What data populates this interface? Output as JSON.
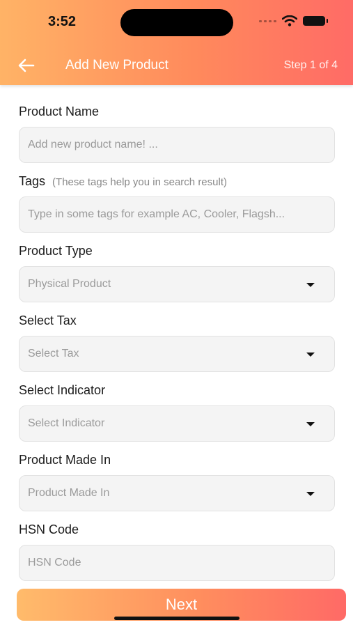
{
  "status_bar": {
    "time": "3:52"
  },
  "header": {
    "title": "Add New Product",
    "step": "Step 1 of 4"
  },
  "form": {
    "product_name": {
      "label": "Product Name",
      "placeholder": "Add new product name! ..."
    },
    "tags": {
      "label": "Tags",
      "hint": "(These tags help you in search result)",
      "placeholder": "Type in some tags for example AC, Cooler, Flagsh..."
    },
    "product_type": {
      "label": "Product Type",
      "value": "Physical Product"
    },
    "tax": {
      "label": "Select Tax",
      "value": "Select Tax"
    },
    "indicator": {
      "label": "Select Indicator",
      "value": "Select Indicator"
    },
    "made_in": {
      "label": "Product Made In",
      "value": "Product Made In"
    },
    "hsn": {
      "label": "HSN Code",
      "placeholder": "HSN Code"
    }
  },
  "footer": {
    "next_label": "Next"
  },
  "colors": {
    "gradient_start": "#ffb366",
    "gradient_end": "#ff6b66"
  }
}
